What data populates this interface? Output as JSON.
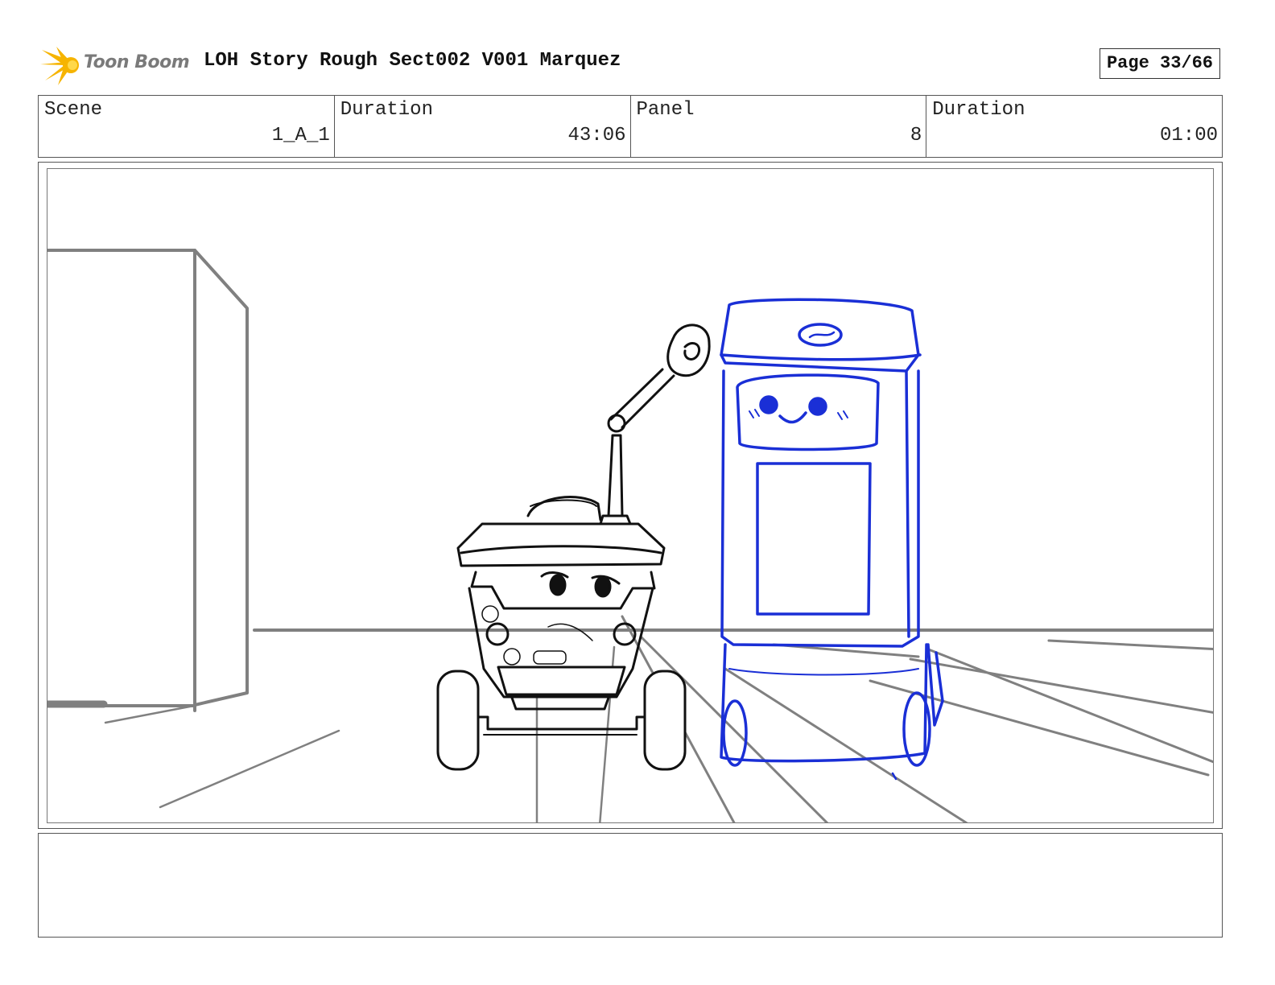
{
  "header": {
    "logo_text": "Toon Boom",
    "title": "LOH Story Rough Sect002 V001 Marquez",
    "page_label": "Page 33/66"
  },
  "info": {
    "scene_label": "Scene",
    "scene_value": "1_A_1",
    "scene_duration_label": "Duration",
    "scene_duration_value": "43:06",
    "panel_label": "Panel",
    "panel_value": "8",
    "panel_duration_label": "Duration",
    "panel_duration_value": "01:00"
  },
  "panel": {
    "drawing": "storyboard-sketch",
    "colors": {
      "background_lines": "#808080",
      "character_a": "#111111",
      "character_b": "#1a2fd6"
    }
  },
  "notes": {
    "text": ""
  }
}
